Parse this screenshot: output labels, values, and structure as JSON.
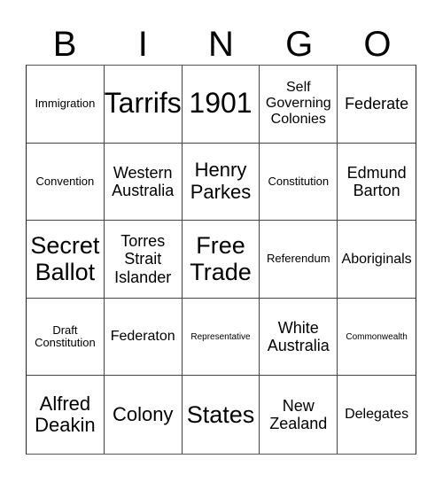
{
  "header": {
    "letters": [
      "B",
      "I",
      "N",
      "G",
      "O"
    ]
  },
  "board": {
    "rows": [
      [
        "Immigration",
        "Tarrifs",
        "1901",
        "Self Governing Colonies",
        "Federate"
      ],
      [
        "Convention",
        "Western Australia",
        "Henry Parkes",
        "Constitution",
        "Edmund Barton"
      ],
      [
        "Secret Ballot",
        "Torres Strait Islander",
        "Free Trade",
        "Referendum",
        "Aboriginals"
      ],
      [
        "Draft Constitution",
        "Federaton",
        "Representative",
        "White Australia",
        "Commonwealth"
      ],
      [
        "Alfred Deakin",
        "Colony",
        "States",
        "New Zealand",
        "Delegates"
      ]
    ]
  }
}
